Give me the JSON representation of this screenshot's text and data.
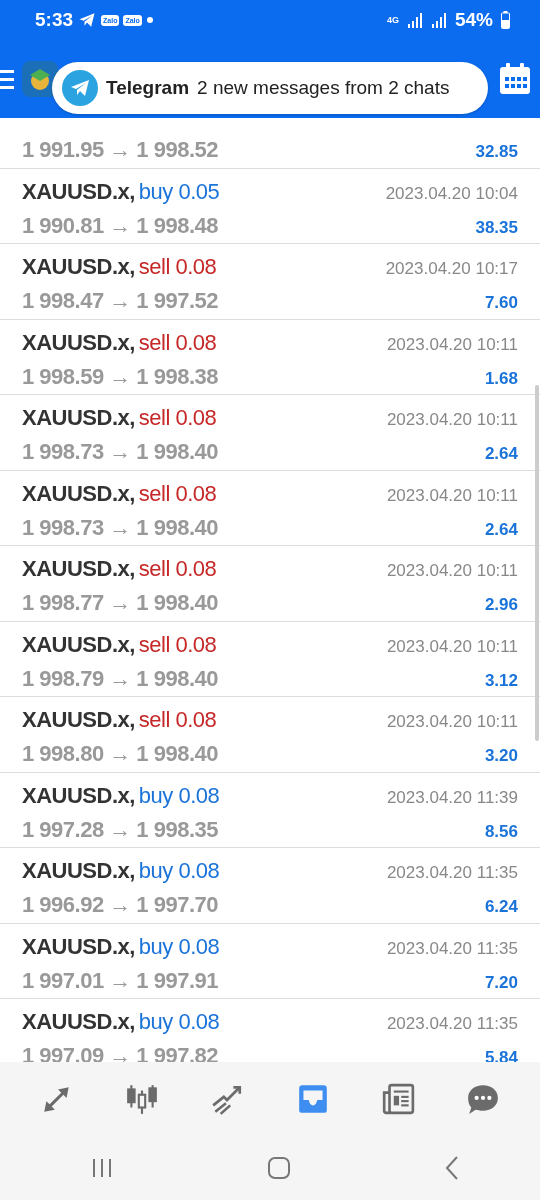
{
  "status_bar": {
    "time": "5:33",
    "app_icons": [
      "Zalo",
      "Zalo"
    ],
    "network": "4G",
    "battery": "54%"
  },
  "notification": {
    "app": "Telegram",
    "message": "2 new messages from 2 chats"
  },
  "deals": [
    {
      "prices": "1 991.95 → 1 998.52",
      "profit": "32.85"
    },
    {
      "symbol": "XAUUSD.x,",
      "kind": "buy",
      "volume": "buy 0.05",
      "prices": "1 990.81 → 1 998.48",
      "time": "2023.04.20 10:04",
      "profit": "38.35"
    },
    {
      "symbol": "XAUUSD.x,",
      "kind": "sell",
      "volume": "sell 0.08",
      "prices": "1 998.47 → 1 997.52",
      "time": "2023.04.20 10:17",
      "profit": "7.60"
    },
    {
      "symbol": "XAUUSD.x,",
      "kind": "sell",
      "volume": "sell 0.08",
      "prices": "1 998.59 → 1 998.38",
      "time": "2023.04.20 10:11",
      "profit": "1.68"
    },
    {
      "symbol": "XAUUSD.x,",
      "kind": "sell",
      "volume": "sell 0.08",
      "prices": "1 998.73 → 1 998.40",
      "time": "2023.04.20 10:11",
      "profit": "2.64"
    },
    {
      "symbol": "XAUUSD.x,",
      "kind": "sell",
      "volume": "sell 0.08",
      "prices": "1 998.73 → 1 998.40",
      "time": "2023.04.20 10:11",
      "profit": "2.64"
    },
    {
      "symbol": "XAUUSD.x,",
      "kind": "sell",
      "volume": "sell 0.08",
      "prices": "1 998.77 → 1 998.40",
      "time": "2023.04.20 10:11",
      "profit": "2.96"
    },
    {
      "symbol": "XAUUSD.x,",
      "kind": "sell",
      "volume": "sell 0.08",
      "prices": "1 998.79 → 1 998.40",
      "time": "2023.04.20 10:11",
      "profit": "3.12"
    },
    {
      "symbol": "XAUUSD.x,",
      "kind": "sell",
      "volume": "sell 0.08",
      "prices": "1 998.80 → 1 998.40",
      "time": "2023.04.20 10:11",
      "profit": "3.20"
    },
    {
      "symbol": "XAUUSD.x,",
      "kind": "buy",
      "volume": "buy 0.08",
      "prices": "1 997.28 → 1 998.35",
      "time": "2023.04.20 11:39",
      "profit": "8.56"
    },
    {
      "symbol": "XAUUSD.x,",
      "kind": "buy",
      "volume": "buy 0.08",
      "prices": "1 996.92 → 1 997.70",
      "time": "2023.04.20 11:35",
      "profit": "6.24"
    },
    {
      "symbol": "XAUUSD.x,",
      "kind": "buy",
      "volume": "buy 0.08",
      "prices": "1 997.01 → 1 997.91",
      "time": "2023.04.20 11:35",
      "profit": "7.20"
    },
    {
      "symbol": "XAUUSD.x,",
      "kind": "buy",
      "volume": "buy 0.08",
      "prices": "1 997.09 → 1 997.82",
      "time": "2023.04.20 11:35",
      "profit": "5.84"
    }
  ],
  "bottom_nav": [
    {
      "kind": "trade",
      "selected": false
    },
    {
      "kind": "candles",
      "selected": false
    },
    {
      "kind": "chart",
      "selected": false
    },
    {
      "kind": "history",
      "selected": true
    },
    {
      "kind": "news",
      "selected": false
    },
    {
      "kind": "chat",
      "selected": false
    }
  ]
}
